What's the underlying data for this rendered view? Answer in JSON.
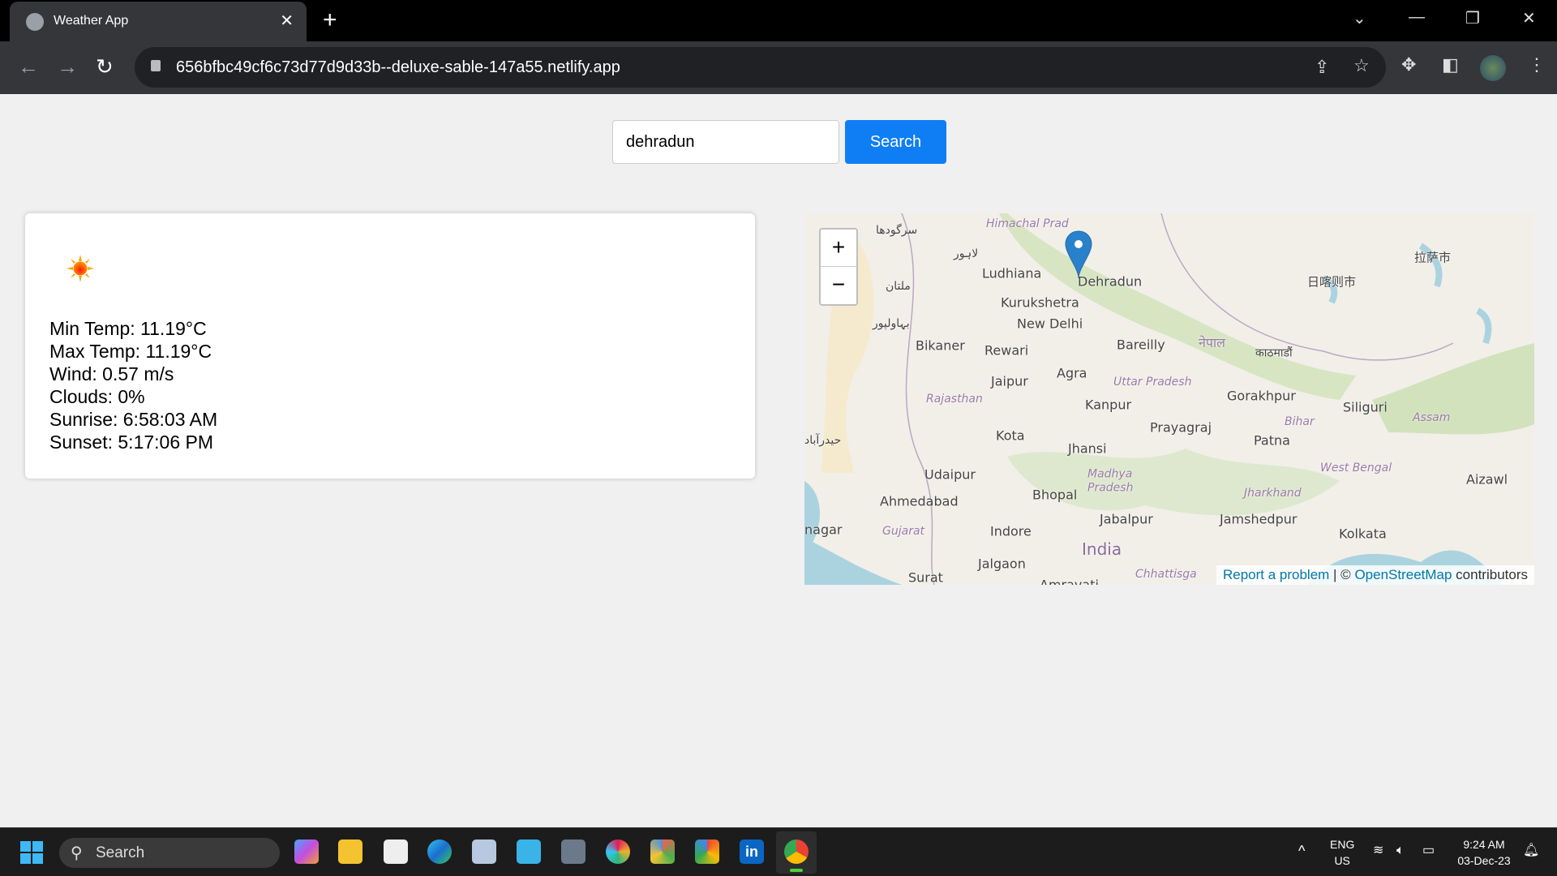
{
  "browser": {
    "tab_title": "Weather App",
    "url": "656bfbc49cf6c73d77d9d33b--deluxe-sable-147a55.netlify.app"
  },
  "search": {
    "value": "dehradun",
    "button_label": "Search"
  },
  "weather": {
    "icon": "sun-icon",
    "min_temp": "Min Temp: 11.19°C",
    "max_temp": "Max Temp: 11.19°C",
    "wind": "Wind: 0.57 m/s",
    "clouds": "Clouds: 0%",
    "sunrise": "Sunrise: 6:58:03 AM",
    "sunset": "Sunset: 5:17:06 PM"
  },
  "map": {
    "zoom_in": "+",
    "zoom_out": "−",
    "marker_label": "Dehradun",
    "labels": {
      "himachal": "Himachal Prad",
      "ludhiana": "Ludhiana",
      "dehradun": "Dehradun",
      "kurukshetra": "Kurukshetra",
      "new_delhi": "New Delhi",
      "bikaner": "Bikaner",
      "rewari": "Rewari",
      "bareilly": "Bareilly",
      "nepal": "नेपाल",
      "kathmandu": "काठमाडौं",
      "jaipur": "Jaipur",
      "agra": "Agra",
      "uttar_pradesh": "Uttar Pradesh",
      "rajasthan": "Rajasthan",
      "kanpur": "Kanpur",
      "gorakhpur": "Gorakhpur",
      "siliguri": "Siliguri",
      "prayagraj": "Prayagraj",
      "kota": "Kota",
      "jhansi": "Jhansi",
      "patna": "Patna",
      "bihar": "Bihar",
      "assam": "Assam",
      "west_bengal": "West Bengal",
      "udaipur": "Udaipur",
      "madhya_pradesh": "Madhya Pradesh",
      "ahmedabad": "Ahmedabad",
      "bhopal": "Bhopal",
      "jharkhand": "Jharkhand",
      "jabalpur": "Jabalpur",
      "jamshedpur": "Jamshedpur",
      "kolkata": "Kolkata",
      "indore": "Indore",
      "gujarat": "Gujarat",
      "india": "India",
      "jalgaon": "Jalgaon",
      "surat": "Surat",
      "aizawl": "Aizawl",
      "nagar": "nagar",
      "chhattisgarh": "Chhattisga",
      "amravati": "Amravati",
      "lhasa": "拉萨市",
      "shigatse": "日喀则市",
      "multan": "ملتان",
      "lahore": "لاہور",
      "sargodha": "سرگودھا",
      "bahawalpur": "بہاولپور",
      "hyderabad_pk": "حیدرآباد"
    },
    "attribution": {
      "report": "Report a problem",
      "sep": " | © ",
      "osm": "OpenStreetMap",
      "contributors": " contributors"
    }
  },
  "taskbar": {
    "search_label": "Search",
    "lang_top": "ENG",
    "lang_bottom": "US",
    "time": "9:24 AM",
    "date": "03-Dec-23"
  }
}
